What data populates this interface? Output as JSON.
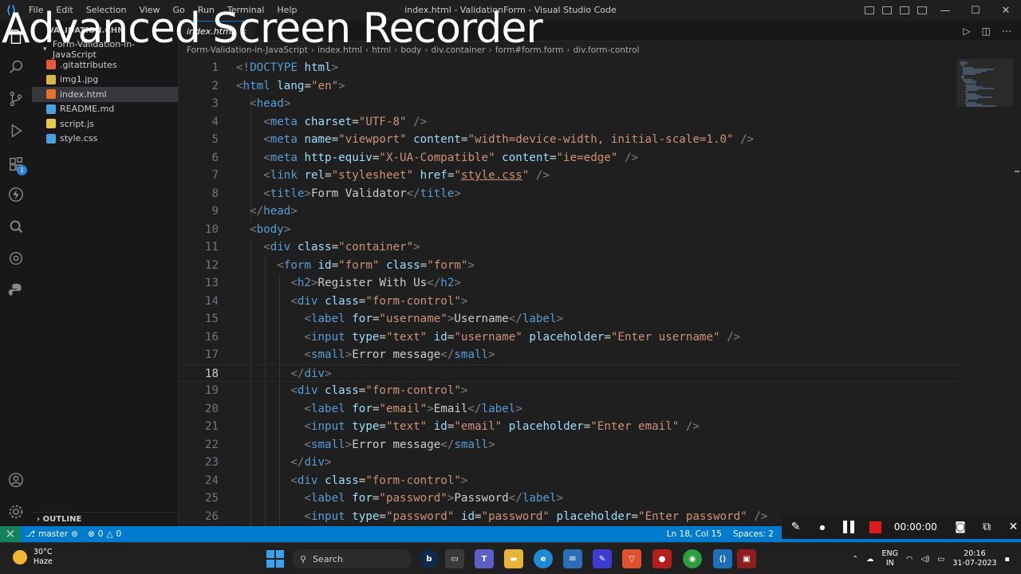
{
  "watermark": "Advanced Screen Recorder",
  "menu": [
    "File",
    "Edit",
    "Selection",
    "View",
    "Go",
    "Run",
    "Terminal",
    "Help"
  ],
  "window_title": "index.html - ValidationForm - Visual Studio Code",
  "sidebar": {
    "header": "VALIDATION.CHM",
    "folder": "Form-Validation-in-JavaScript",
    "files": [
      {
        "name": ".gitattributes",
        "icon": "git-icon",
        "color": "#e8593c"
      },
      {
        "name": "img1.jpg",
        "icon": "image-icon",
        "color": "#d9b84a"
      },
      {
        "name": "index.html",
        "icon": "html-icon",
        "color": "#e5732e"
      },
      {
        "name": "README.md",
        "icon": "info-icon",
        "color": "#4a9fdc"
      },
      {
        "name": "script.js",
        "icon": "js-icon",
        "color": "#e4c84a"
      },
      {
        "name": "style.css",
        "icon": "css-icon",
        "color": "#4a9fdc"
      }
    ],
    "outline": "OUTLINE"
  },
  "tab": {
    "label": "index.html",
    "close": "×"
  },
  "breadcrumb": [
    "Form-Validation-in-JavaScript",
    "index.html",
    "html",
    "body",
    "div.container",
    "form#form.form",
    "div.form-control"
  ],
  "code": [
    {
      "n": "1",
      "parts": [
        [
          "p",
          "<!"
        ],
        [
          "t",
          "DOCTYPE"
        ],
        [
          "x",
          " "
        ],
        [
          "a",
          "html"
        ],
        [
          "p",
          ">"
        ]
      ]
    },
    {
      "n": "2",
      "parts": [
        [
          "p",
          "<"
        ],
        [
          "t",
          "html"
        ],
        [
          "x",
          " "
        ],
        [
          "a",
          "lang"
        ],
        [
          "x",
          "="
        ],
        [
          "s",
          "\"en\""
        ],
        [
          "p",
          ">"
        ]
      ]
    },
    {
      "n": "3",
      "parts": [
        [
          "x",
          "  "
        ],
        [
          "p",
          "<"
        ],
        [
          "t",
          "head"
        ],
        [
          "p",
          ">"
        ]
      ]
    },
    {
      "n": "4",
      "parts": [
        [
          "x",
          "    "
        ],
        [
          "p",
          "<"
        ],
        [
          "t",
          "meta"
        ],
        [
          "x",
          " "
        ],
        [
          "a",
          "charset"
        ],
        [
          "x",
          "="
        ],
        [
          "s",
          "\"UTF-8\""
        ],
        [
          "x",
          " "
        ],
        [
          "p",
          "/>"
        ]
      ]
    },
    {
      "n": "5",
      "parts": [
        [
          "x",
          "    "
        ],
        [
          "p",
          "<"
        ],
        [
          "t",
          "meta"
        ],
        [
          "x",
          " "
        ],
        [
          "a",
          "name"
        ],
        [
          "x",
          "="
        ],
        [
          "s",
          "\"viewport\""
        ],
        [
          "x",
          " "
        ],
        [
          "a",
          "content"
        ],
        [
          "x",
          "="
        ],
        [
          "s",
          "\"width=device-width, initial-scale=1.0\""
        ],
        [
          "x",
          " "
        ],
        [
          "p",
          "/>"
        ]
      ]
    },
    {
      "n": "6",
      "parts": [
        [
          "x",
          "    "
        ],
        [
          "p",
          "<"
        ],
        [
          "t",
          "meta"
        ],
        [
          "x",
          " "
        ],
        [
          "a",
          "http-equiv"
        ],
        [
          "x",
          "="
        ],
        [
          "s",
          "\"X-UA-Compatible\""
        ],
        [
          "x",
          " "
        ],
        [
          "a",
          "content"
        ],
        [
          "x",
          "="
        ],
        [
          "s",
          "\"ie=edge\""
        ],
        [
          "x",
          " "
        ],
        [
          "p",
          "/>"
        ]
      ]
    },
    {
      "n": "7",
      "parts": [
        [
          "x",
          "    "
        ],
        [
          "p",
          "<"
        ],
        [
          "t",
          "link"
        ],
        [
          "x",
          " "
        ],
        [
          "a",
          "rel"
        ],
        [
          "x",
          "="
        ],
        [
          "s",
          "\"stylesheet\""
        ],
        [
          "x",
          " "
        ],
        [
          "a",
          "href"
        ],
        [
          "x",
          "="
        ],
        [
          "s",
          "\""
        ],
        [
          "su",
          "style.css"
        ],
        [
          "s",
          "\""
        ],
        [
          "x",
          " "
        ],
        [
          "p",
          "/>"
        ]
      ]
    },
    {
      "n": "8",
      "parts": [
        [
          "x",
          "    "
        ],
        [
          "p",
          "<"
        ],
        [
          "t",
          "title"
        ],
        [
          "p",
          ">"
        ],
        [
          "x",
          "Form Validator"
        ],
        [
          "p",
          "</"
        ],
        [
          "t",
          "title"
        ],
        [
          "p",
          ">"
        ]
      ]
    },
    {
      "n": "9",
      "parts": [
        [
          "x",
          "  "
        ],
        [
          "p",
          "</"
        ],
        [
          "t",
          "head"
        ],
        [
          "p",
          ">"
        ]
      ]
    },
    {
      "n": "10",
      "parts": [
        [
          "x",
          "  "
        ],
        [
          "p",
          "<"
        ],
        [
          "t",
          "body"
        ],
        [
          "p",
          ">"
        ]
      ]
    },
    {
      "n": "11",
      "parts": [
        [
          "x",
          "    "
        ],
        [
          "p",
          "<"
        ],
        [
          "t",
          "div"
        ],
        [
          "x",
          " "
        ],
        [
          "a",
          "class"
        ],
        [
          "x",
          "="
        ],
        [
          "s",
          "\"container\""
        ],
        [
          "p",
          ">"
        ]
      ]
    },
    {
      "n": "12",
      "parts": [
        [
          "x",
          "      "
        ],
        [
          "p",
          "<"
        ],
        [
          "t",
          "form"
        ],
        [
          "x",
          " "
        ],
        [
          "a",
          "id"
        ],
        [
          "x",
          "="
        ],
        [
          "s",
          "\"form\""
        ],
        [
          "x",
          " "
        ],
        [
          "a",
          "class"
        ],
        [
          "x",
          "="
        ],
        [
          "s",
          "\"form\""
        ],
        [
          "p",
          ">"
        ]
      ]
    },
    {
      "n": "13",
      "parts": [
        [
          "x",
          "        "
        ],
        [
          "p",
          "<"
        ],
        [
          "t",
          "h2"
        ],
        [
          "p",
          ">"
        ],
        [
          "x",
          "Register With Us"
        ],
        [
          "p",
          "</"
        ],
        [
          "t",
          "h2"
        ],
        [
          "p",
          ">"
        ]
      ]
    },
    {
      "n": "14",
      "parts": [
        [
          "x",
          "        "
        ],
        [
          "p",
          "<"
        ],
        [
          "t",
          "div"
        ],
        [
          "x",
          " "
        ],
        [
          "a",
          "class"
        ],
        [
          "x",
          "="
        ],
        [
          "s",
          "\"form-control\""
        ],
        [
          "p",
          ">"
        ]
      ]
    },
    {
      "n": "15",
      "parts": [
        [
          "x",
          "          "
        ],
        [
          "p",
          "<"
        ],
        [
          "t",
          "label"
        ],
        [
          "x",
          " "
        ],
        [
          "a",
          "for"
        ],
        [
          "x",
          "="
        ],
        [
          "s",
          "\"username\""
        ],
        [
          "p",
          ">"
        ],
        [
          "x",
          "Username"
        ],
        [
          "p",
          "</"
        ],
        [
          "t",
          "label"
        ],
        [
          "p",
          ">"
        ]
      ]
    },
    {
      "n": "16",
      "parts": [
        [
          "x",
          "          "
        ],
        [
          "p",
          "<"
        ],
        [
          "t",
          "input"
        ],
        [
          "x",
          " "
        ],
        [
          "a",
          "type"
        ],
        [
          "x",
          "="
        ],
        [
          "s",
          "\"text\""
        ],
        [
          "x",
          " "
        ],
        [
          "a",
          "id"
        ],
        [
          "x",
          "="
        ],
        [
          "s",
          "\"username\""
        ],
        [
          "x",
          " "
        ],
        [
          "a",
          "placeholder"
        ],
        [
          "x",
          "="
        ],
        [
          "s",
          "\"Enter username\""
        ],
        [
          "x",
          " "
        ],
        [
          "p",
          "/>"
        ]
      ]
    },
    {
      "n": "17",
      "parts": [
        [
          "x",
          "          "
        ],
        [
          "p",
          "<"
        ],
        [
          "t",
          "small"
        ],
        [
          "p",
          ">"
        ],
        [
          "x",
          "Error message"
        ],
        [
          "p",
          "</"
        ],
        [
          "t",
          "small"
        ],
        [
          "p",
          ">"
        ]
      ]
    },
    {
      "n": "18",
      "parts": [
        [
          "x",
          "        "
        ],
        [
          "p",
          "</"
        ],
        [
          "t",
          "div"
        ],
        [
          "p",
          ">"
        ]
      ]
    },
    {
      "n": "19",
      "parts": [
        [
          "x",
          "        "
        ],
        [
          "p",
          "<"
        ],
        [
          "t",
          "div"
        ],
        [
          "x",
          " "
        ],
        [
          "a",
          "class"
        ],
        [
          "x",
          "="
        ],
        [
          "s",
          "\"form-control\""
        ],
        [
          "p",
          ">"
        ]
      ]
    },
    {
      "n": "20",
      "parts": [
        [
          "x",
          "          "
        ],
        [
          "p",
          "<"
        ],
        [
          "t",
          "label"
        ],
        [
          "x",
          " "
        ],
        [
          "a",
          "for"
        ],
        [
          "x",
          "="
        ],
        [
          "s",
          "\"email\""
        ],
        [
          "p",
          ">"
        ],
        [
          "x",
          "Email"
        ],
        [
          "p",
          "</"
        ],
        [
          "t",
          "label"
        ],
        [
          "p",
          ">"
        ]
      ]
    },
    {
      "n": "21",
      "parts": [
        [
          "x",
          "          "
        ],
        [
          "p",
          "<"
        ],
        [
          "t",
          "input"
        ],
        [
          "x",
          " "
        ],
        [
          "a",
          "type"
        ],
        [
          "x",
          "="
        ],
        [
          "s",
          "\"text\""
        ],
        [
          "x",
          " "
        ],
        [
          "a",
          "id"
        ],
        [
          "x",
          "="
        ],
        [
          "s",
          "\"email\""
        ],
        [
          "x",
          " "
        ],
        [
          "a",
          "placeholder"
        ],
        [
          "x",
          "="
        ],
        [
          "s",
          "\"Enter email\""
        ],
        [
          "x",
          " "
        ],
        [
          "p",
          "/>"
        ]
      ]
    },
    {
      "n": "22",
      "parts": [
        [
          "x",
          "          "
        ],
        [
          "p",
          "<"
        ],
        [
          "t",
          "small"
        ],
        [
          "p",
          ">"
        ],
        [
          "x",
          "Error message"
        ],
        [
          "p",
          "</"
        ],
        [
          "t",
          "small"
        ],
        [
          "p",
          ">"
        ]
      ]
    },
    {
      "n": "23",
      "parts": [
        [
          "x",
          "        "
        ],
        [
          "p",
          "</"
        ],
        [
          "t",
          "div"
        ],
        [
          "p",
          ">"
        ]
      ]
    },
    {
      "n": "24",
      "parts": [
        [
          "x",
          "        "
        ],
        [
          "p",
          "<"
        ],
        [
          "t",
          "div"
        ],
        [
          "x",
          " "
        ],
        [
          "a",
          "class"
        ],
        [
          "x",
          "="
        ],
        [
          "s",
          "\"form-control\""
        ],
        [
          "p",
          ">"
        ]
      ]
    },
    {
      "n": "25",
      "parts": [
        [
          "x",
          "          "
        ],
        [
          "p",
          "<"
        ],
        [
          "t",
          "label"
        ],
        [
          "x",
          " "
        ],
        [
          "a",
          "for"
        ],
        [
          "x",
          "="
        ],
        [
          "s",
          "\"password\""
        ],
        [
          "p",
          ">"
        ],
        [
          "x",
          "Password"
        ],
        [
          "p",
          "</"
        ],
        [
          "t",
          "label"
        ],
        [
          "p",
          ">"
        ]
      ]
    },
    {
      "n": "26",
      "parts": [
        [
          "x",
          "          "
        ],
        [
          "p",
          "<"
        ],
        [
          "t",
          "input"
        ],
        [
          "x",
          " "
        ],
        [
          "a",
          "type"
        ],
        [
          "x",
          "="
        ],
        [
          "s",
          "\"password\""
        ],
        [
          "x",
          " "
        ],
        [
          "a",
          "id"
        ],
        [
          "x",
          "="
        ],
        [
          "s",
          "\"password\""
        ],
        [
          "x",
          " "
        ],
        [
          "a",
          "placeholder"
        ],
        [
          "x",
          "="
        ],
        [
          "s",
          "\"Enter password\""
        ],
        [
          "x",
          " "
        ],
        [
          "p",
          "/>"
        ]
      ]
    }
  ],
  "current_line": "18",
  "status": {
    "branch": "master",
    "errors": "0",
    "warnings": "0",
    "position": "Ln 18, Col 15",
    "spaces": "Spaces: 2"
  },
  "recorder": {
    "time": "00:00:00"
  },
  "taskbar": {
    "temp": "30°C",
    "weather": "Haze",
    "search": "Search",
    "lang1": "ENG",
    "lang2": "IN",
    "time": "20:16",
    "date": "31-07-2023"
  },
  "colors": {
    "accent": "#007acc",
    "remote": "#16825d",
    "record": "#e01a1a"
  }
}
